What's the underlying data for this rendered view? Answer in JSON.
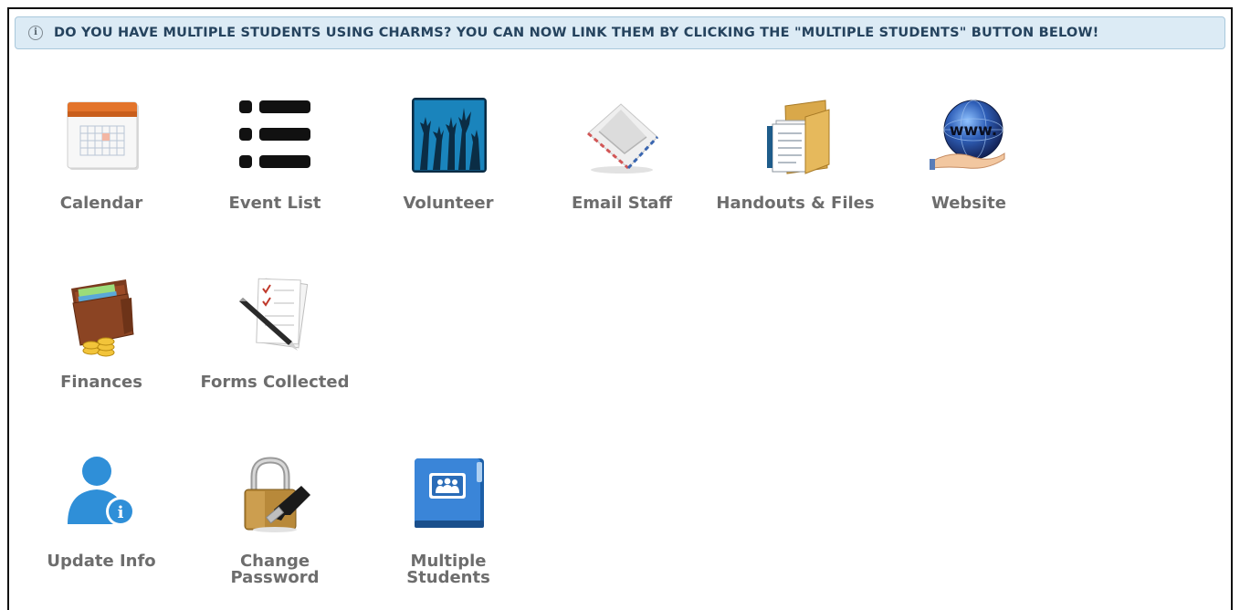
{
  "notice": {
    "text": "DO YOU HAVE MULTIPLE STUDENTS USING CHARMS? YOU CAN NOW LINK THEM BY CLICKING THE \"MULTIPLE STUDENTS\" BUTTON BELOW!",
    "icon": "info-icon"
  },
  "tiles": {
    "calendar": {
      "label": "Calendar",
      "icon": "calendar-icon"
    },
    "event_list": {
      "label": "Event List",
      "icon": "list-icon"
    },
    "volunteer": {
      "label": "Volunteer",
      "icon": "raised-hands-icon"
    },
    "email_staff": {
      "label": "Email Staff",
      "icon": "envelope-icon"
    },
    "handouts": {
      "label": "Handouts & Files",
      "icon": "folder-icon"
    },
    "website": {
      "label": "Website",
      "icon": "globe-icon"
    },
    "finances": {
      "label": "Finances",
      "icon": "wallet-icon"
    },
    "forms": {
      "label": "Forms Collected",
      "icon": "forms-icon"
    },
    "update_info": {
      "label": "Update Info",
      "icon": "user-info-icon"
    },
    "change_password": {
      "label": "Change Password",
      "icon": "padlock-icon"
    },
    "multiple_students": {
      "label": "Multiple Students",
      "icon": "students-folder-icon"
    }
  },
  "colors": {
    "notice_bg": "#dcebf5",
    "notice_text": "#25435e",
    "label": "#6d6d6d",
    "accent_blue": "#1f6fc0"
  }
}
